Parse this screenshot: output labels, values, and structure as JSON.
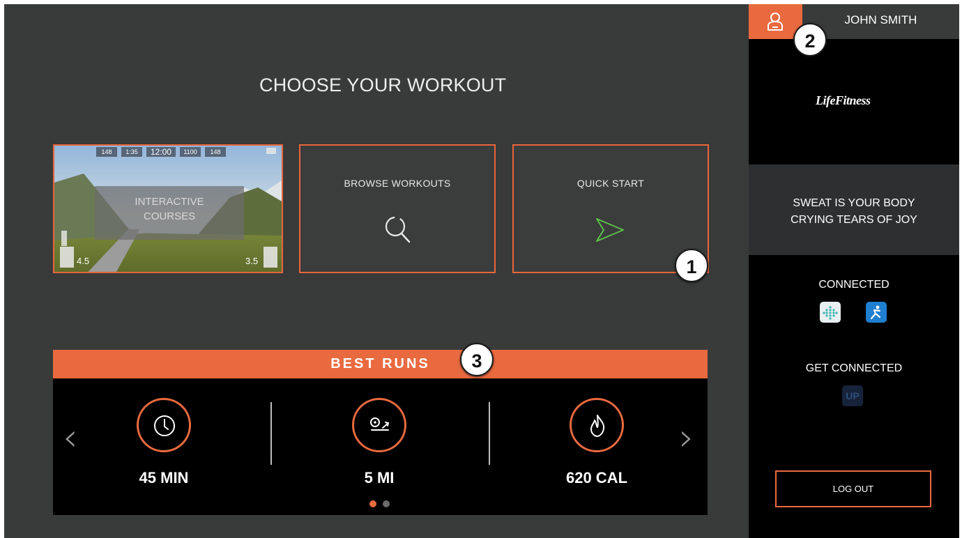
{
  "main": {
    "title": "CHOOSE YOUR WORKOUT",
    "tiles": {
      "interactive": {
        "label_line1": "INTERACTIVE",
        "label_line2": "COURSES",
        "hud": [
          "148",
          "1:35",
          "12:00",
          "1100",
          "148"
        ],
        "speed_left": "4.5",
        "speed_right": "3.5"
      },
      "browse": {
        "label": "BROWSE WORKOUTS",
        "icon": "search-icon"
      },
      "quick": {
        "label": "QUICK START",
        "icon": "play-icon"
      }
    }
  },
  "best_runs": {
    "title": "BEST RUNS",
    "stats": [
      {
        "icon": "clock-icon",
        "value": "45 MIN"
      },
      {
        "icon": "distance-icon",
        "value": "5 MI"
      },
      {
        "icon": "flame-icon",
        "value": "620 CAL"
      }
    ],
    "page": 1,
    "page_count": 2
  },
  "sidebar": {
    "user_name": "JOHN SMITH",
    "brand": "LifeFitness",
    "quote_line1": "SWEAT IS YOUR BODY",
    "quote_line2": "CRYING TEARS OF JOY",
    "connected_label": "CONNECTED",
    "connected_apps": [
      "fitbit-icon",
      "under-armour-icon"
    ],
    "get_connected_label": "GET CONNECTED",
    "get_connected_apps": [
      {
        "icon": "jawbone-up-icon",
        "label": "UP"
      }
    ],
    "logout_label": "LOG OUT"
  },
  "callouts": [
    "1",
    "2",
    "3"
  ],
  "colors": {
    "accent": "#ea6a3f",
    "background": "#393a3a",
    "sidebar": "#000000",
    "play_icon": "#5cc84a"
  }
}
